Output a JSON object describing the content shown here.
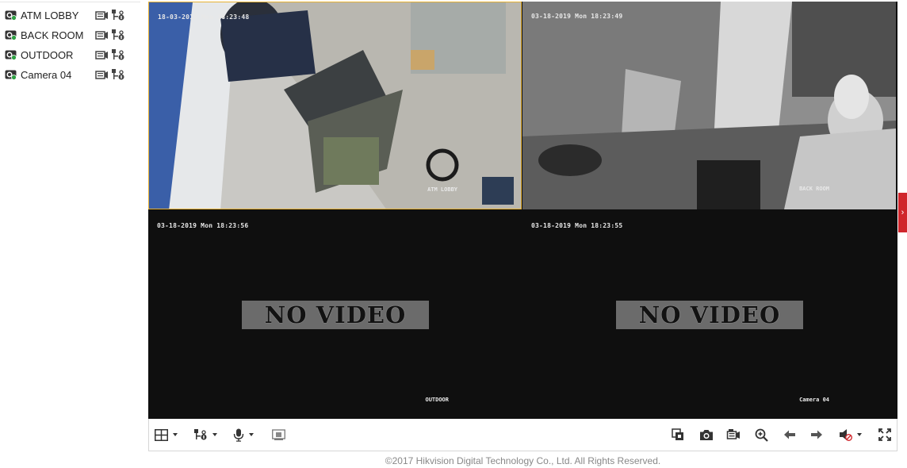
{
  "cameras": [
    {
      "name": "ATM LOBBY"
    },
    {
      "name": "BACK ROOM"
    },
    {
      "name": "OUTDOOR"
    },
    {
      "name": "Camera 04"
    }
  ],
  "tiles": [
    {
      "timestamp": "18-03-2019 Mon 18:23:48",
      "label": "ATM LOBBY",
      "status": "live",
      "selected": true
    },
    {
      "timestamp": "03-18-2019 Mon 18:23:49",
      "label": "BACK ROOM",
      "status": "live"
    },
    {
      "timestamp": "03-18-2019 Mon 18:23:56",
      "label": "OUTDOOR",
      "status": "no-video",
      "overlay": "NO VIDEO"
    },
    {
      "timestamp": "03-18-2019 Mon 18:23:55",
      "label": "Camera 04",
      "status": "no-video",
      "overlay": "NO VIDEO"
    }
  ],
  "toolbar": {
    "left": [
      "layout-grid-icon",
      "ptz-icon",
      "microphone-icon",
      "e-zoom-icon"
    ],
    "right": [
      "stop-all-icon",
      "capture-icon",
      "record-icon",
      "zoom-in-icon",
      "prev-page-icon",
      "next-page-icon",
      "audio-muted-icon",
      "fullscreen-icon"
    ]
  },
  "footer": {
    "copyright": "©2017 Hikvision Digital Technology Co., Ltd. All Rights Reserved."
  },
  "colors": {
    "selected_border": "#e8b233",
    "side_tab": "#d0262c",
    "cam_online": "#2ea043"
  }
}
